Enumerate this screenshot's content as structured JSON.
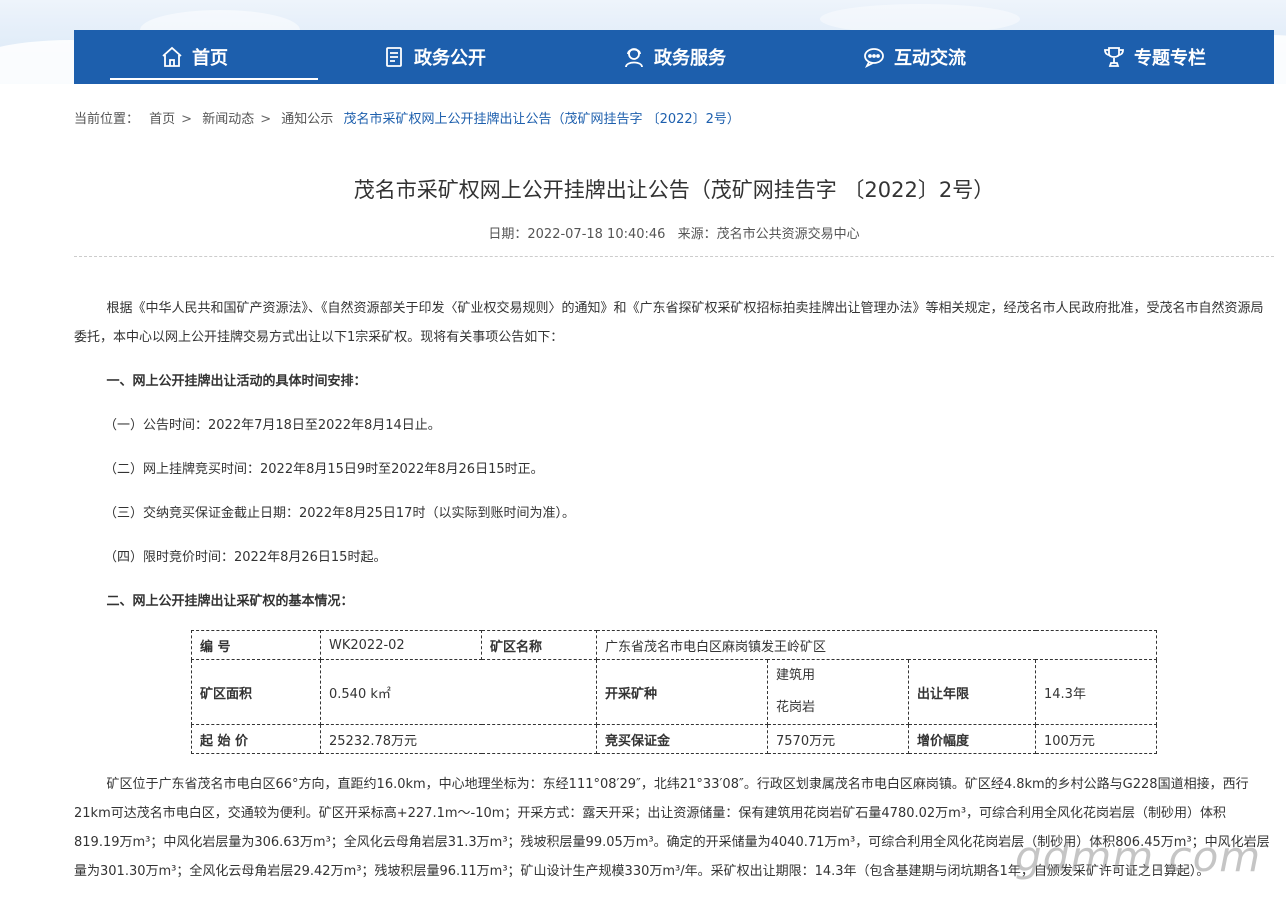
{
  "nav": {
    "items": [
      {
        "label": "首页",
        "icon": "home-icon"
      },
      {
        "label": "政务公开",
        "icon": "document-icon"
      },
      {
        "label": "政务服务",
        "icon": "service-person-icon"
      },
      {
        "label": "互动交流",
        "icon": "chat-icon"
      },
      {
        "label": "专题专栏",
        "icon": "trophy-icon"
      }
    ]
  },
  "breadcrumb": {
    "prefix": "当前位置：",
    "items": [
      "首页",
      "新闻动态",
      "通知公示"
    ],
    "current": "茂名市采矿权网上公开挂牌出让公告（茂矿网挂告字 〔2022〕2号）"
  },
  "article": {
    "title": "茂名市采矿权网上公开挂牌出让公告（茂矿网挂告字 〔2022〕2号）",
    "date_label": "日期：",
    "date": "2022-07-18 10:40:46",
    "source_label": "来源：",
    "source": "茂名市公共资源交易中心",
    "intro": "根据《中华人民共和国矿产资源法》、《自然资源部关于印发〈矿业权交易规则〉的通知》和《广东省探矿权采矿权招标拍卖挂牌出让管理办法》等相关规定，经茂名市人民政府批准，受茂名市自然资源局委托，本中心以网上公开挂牌交易方式出让以下1宗采矿权。现将有关事项公告如下：",
    "section1": "一、网上公开挂牌出让活动的具体时间安排：",
    "item1": "（一）公告时间：2022年7月18日至2022年8月14日止。",
    "item2": "（二）网上挂牌竞买时间：2022年8月15日9时至2022年8月26日15时正。",
    "item3": "（三）交纳竞买保证金截止日期：2022年8月25日17时（以实际到账时间为准）。",
    "item4": "（四）限时竞价时间：2022年8月26日15时起。",
    "section2": "二、网上公开挂牌出让采矿权的基本情况：",
    "details": "矿区位于广东省茂名市电白区66°方向，直距约16.0km，中心地理坐标为：东经111°08′29″，北纬21°33′08″。行政区划隶属茂名市电白区麻岗镇。矿区经4.8km的乡村公路与G228国道相接，西行21km可达茂名市电白区，交通较为便利。矿区开采标高+227.1m～-10m；开采方式：露天开采；出让资源储量：保有建筑用花岗岩矿石量4780.02万m³，可综合利用全风化花岗岩层（制砂用）体积819.19万m³；中风化岩层量为306.63万m³；全风化云母角岩层31.3万m³；残坡积层量99.05万m³。确定的开采储量为4040.71万m³，可综合利用全风化花岗岩层（制砂用）体积806.45万m³；中风化岩层量为301.30万m³；全风化云母角岩层29.42万m³；残坡积层量96.11万m³；矿山设计生产规模330万m³/年。采矿权出让期限：14.3年（包含基建期与闭坑期各1年，自颁发采矿许可证之日算起）。"
  },
  "table": {
    "row1": {
      "label_no": "编 号",
      "no": "WK2022-02",
      "label_name": "矿区名称",
      "name": "广东省茂名市电白区麻岗镇发王岭矿区"
    },
    "row2": {
      "label_area": "矿区面积",
      "area": "0.540 k㎡",
      "label_mineral": "开采矿种",
      "mineral_line1": "建筑用",
      "mineral_line2": "花岗岩",
      "label_term": "出让年限",
      "term": "14.3年"
    },
    "row3": {
      "label_price": "起 始 价",
      "price": "25232.78万元",
      "label_deposit": "竞买保证金",
      "deposit": "7570万元",
      "label_increment": "增价幅度",
      "increment": "100万元"
    }
  },
  "watermark": "gdmm.com",
  "colors": {
    "nav_bg": "#1d5fad",
    "link": "#1d5fad"
  }
}
